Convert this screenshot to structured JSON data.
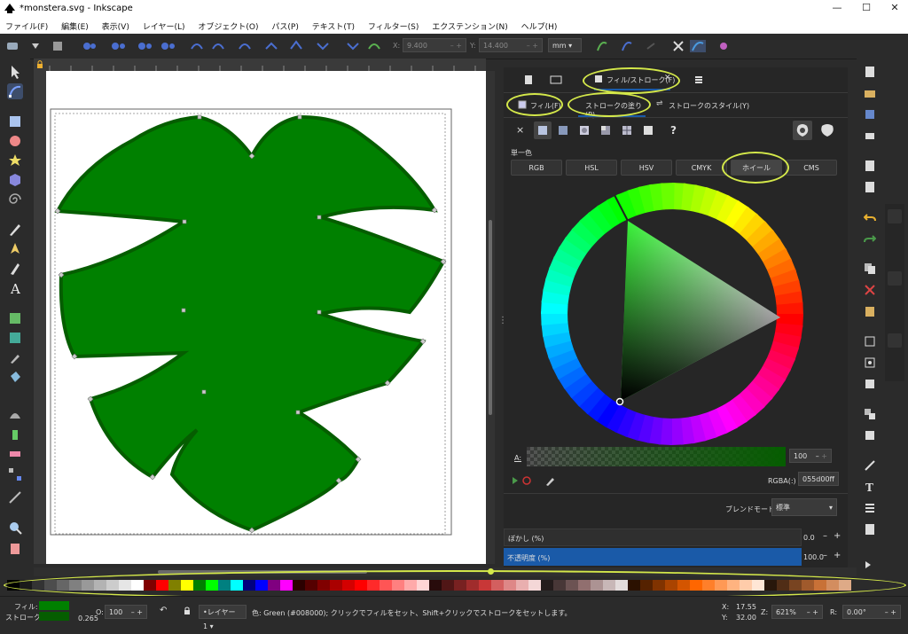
{
  "window": {
    "title": "*monstera.svg - Inkscape",
    "min_icon": "minimize-icon",
    "max_icon": "maximize-icon",
    "close_icon": "close-icon"
  },
  "menubar": [
    "ファイル(F)",
    "編集(E)",
    "表示(V)",
    "レイヤー(L)",
    "オブジェクト(O)",
    "パス(P)",
    "テキスト(T)",
    "フィルター(S)",
    "エクステンション(N)",
    "ヘルプ(H)"
  ],
  "toolbar": {
    "x_label": "X:",
    "x_value": "9.400",
    "y_label": "Y:",
    "y_value": "14.400",
    "unit": "mm"
  },
  "panel": {
    "tabs": [
      "フィル/ストローク(F)"
    ],
    "subtabs": {
      "fill": "フィル(F)",
      "stroke_paint": "ストロークの塗り(P)",
      "stroke_style": "ストロークのスタイル(Y)"
    },
    "paint_x": "×",
    "paint_unknown": "?",
    "flat_label": "単一色",
    "modes": [
      "RGB",
      "HSL",
      "HSV",
      "CMYK",
      "ホイール",
      "CMS"
    ],
    "alpha_label": "A:",
    "alpha_value": "100",
    "rgba_label": "RGBA(:)",
    "rgba_value": "055d00ff",
    "blend_label": "ブレンドモード:",
    "blend_value": "標準",
    "blur_label": "ぼかし (%)",
    "blur_value": "0.0",
    "opacity_label": "不透明度 (%)",
    "opacity_value": "100.0"
  },
  "statusbar": {
    "fill_label": "フィル:",
    "stroke_label": "ストローク:",
    "stroke_width": "0.265",
    "o_label": "O:",
    "o_value": "100",
    "layer": "•レイヤー 1",
    "message": "色: Green (#008000); クリックでフィルをセット、Shift+クリックでストロークをセットします。",
    "x_label": "X:",
    "x_value": "17.55",
    "y_label": "Y:",
    "y_value": "32.00",
    "z_label": "Z:",
    "zoom": "621%",
    "r_label": "R:",
    "rotation": "0.00°"
  },
  "colors": {
    "accent": "#1a5aa8",
    "highlight": "#d4e84a",
    "leaf": "#008000",
    "leaf_stroke": "#055d00"
  }
}
